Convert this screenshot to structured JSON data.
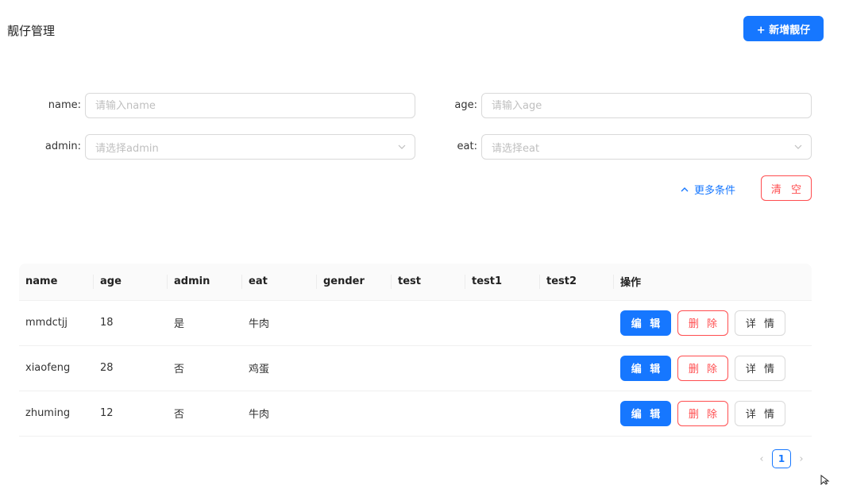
{
  "header": {
    "title": "靓仔管理",
    "add_button": "+ 新增靓仔"
  },
  "filters": {
    "name": {
      "label": "name:",
      "placeholder": "请输入name"
    },
    "age": {
      "label": "age:",
      "placeholder": "请输入age"
    },
    "admin": {
      "label": "admin:",
      "placeholder": "请选择admin"
    },
    "eat": {
      "label": "eat:",
      "placeholder": "请选择eat"
    },
    "more_label": "更多条件",
    "clear_label": "清 空"
  },
  "table": {
    "columns": [
      "name",
      "age",
      "admin",
      "eat",
      "gender",
      "test",
      "test1",
      "test2",
      "操作"
    ],
    "rows": [
      {
        "name": "mmdctjj",
        "age": "18",
        "admin": "是",
        "eat": "牛肉"
      },
      {
        "name": "xiaofeng",
        "age": "28",
        "admin": "否",
        "eat": "鸡蛋"
      },
      {
        "name": "zhuming",
        "age": "12",
        "admin": "否",
        "eat": "牛肉"
      }
    ],
    "actions": {
      "edit": "编 辑",
      "delete": "删 除",
      "detail": "详 情"
    }
  },
  "pagination": {
    "current": "1"
  },
  "colors": {
    "primary": "#1677ff",
    "danger": "#ff4d4f",
    "border": "#d9d9d9"
  }
}
